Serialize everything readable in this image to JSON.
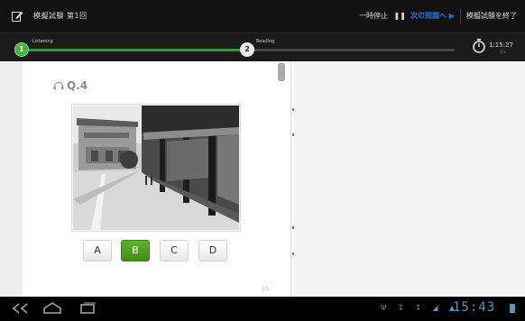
{
  "topbar": {
    "title": "模擬試験 第1回",
    "pause_label": "一時停止",
    "pause_icon": "pause-icon",
    "next_label": "次の問題へ",
    "next_icon": "play-icon",
    "finish_label": "模擬試験を終了",
    "accent": "#1e74d2"
  },
  "progress": {
    "steps": [
      {
        "number": "1",
        "label": "Listening"
      },
      {
        "number": "2",
        "label": "Reading"
      }
    ],
    "fill": 0.52,
    "fill_color": "#2e9e3f",
    "timer": "1:15:27",
    "timer_sub": "1/1"
  },
  "question": {
    "number": "Q.4",
    "icon": "headphone-icon",
    "options": [
      "A",
      "B",
      "C",
      "D"
    ],
    "selected": "B",
    "selected_color": "#4fa022",
    "page": "1/1"
  },
  "navbar": {
    "clock": "15:43",
    "icons": [
      "back-icon",
      "home-icon",
      "recent-apps-icon",
      "usb-icon",
      "download-icon",
      "wifi-icon",
      "battery-icon"
    ]
  }
}
